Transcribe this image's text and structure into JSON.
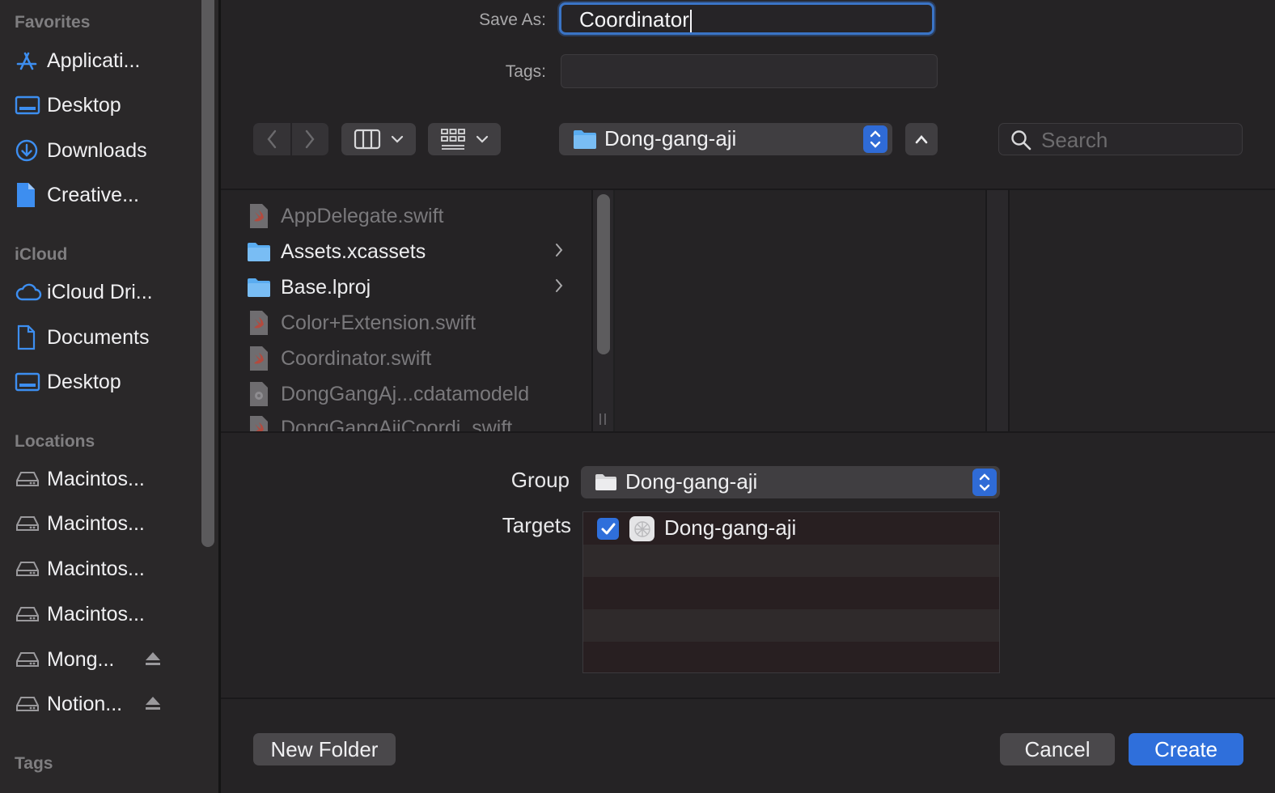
{
  "sidebar": {
    "favorites_heading": "Favorites",
    "favorites": [
      {
        "label": "Applicati...",
        "icon": "applications-icon"
      },
      {
        "label": "Desktop",
        "icon": "desktop-icon"
      },
      {
        "label": "Downloads",
        "icon": "downloads-icon"
      },
      {
        "label": "Creative...",
        "icon": "document-icon"
      }
    ],
    "icloud_heading": "iCloud",
    "icloud": [
      {
        "label": "iCloud Dri...",
        "icon": "icloud-icon"
      },
      {
        "label": "Documents",
        "icon": "document-outline-icon"
      },
      {
        "label": "Desktop",
        "icon": "desktop-icon"
      }
    ],
    "locations_heading": "Locations",
    "locations": [
      {
        "label": "Macintos...",
        "icon": "disk-icon",
        "eject": false
      },
      {
        "label": "Macintos...",
        "icon": "disk-icon",
        "eject": false
      },
      {
        "label": "Macintos...",
        "icon": "disk-icon",
        "eject": false
      },
      {
        "label": "Macintos...",
        "icon": "disk-icon",
        "eject": false
      },
      {
        "label": "Mong...",
        "icon": "disk-icon",
        "eject": true
      },
      {
        "label": "Notion...",
        "icon": "disk-icon",
        "eject": true
      }
    ],
    "tags_heading": "Tags"
  },
  "form": {
    "save_as_label": "Save As:",
    "save_as_value": "Coordinator",
    "tags_label": "Tags:",
    "tags_value": ""
  },
  "toolbar": {
    "path_folder": "Dong-gang-aji",
    "search_placeholder": "Search"
  },
  "files": [
    {
      "name": "AppDelegate.swift",
      "type": "swift",
      "enabled": false,
      "has_children": false
    },
    {
      "name": "Assets.xcassets",
      "type": "folder",
      "enabled": true,
      "has_children": true
    },
    {
      "name": "Base.lproj",
      "type": "folder",
      "enabled": true,
      "has_children": true
    },
    {
      "name": "Color+Extension.swift",
      "type": "swift",
      "enabled": false,
      "has_children": false
    },
    {
      "name": "Coordinator.swift",
      "type": "swift",
      "enabled": false,
      "has_children": false
    },
    {
      "name": "DongGangAj...cdatamodeld",
      "type": "datamodel",
      "enabled": false,
      "has_children": false
    },
    {
      "name": "DongGangAjiCoordi..swift",
      "type": "swift",
      "enabled": false,
      "has_children": false
    }
  ],
  "options": {
    "group_label": "Group",
    "group_value": "Dong-gang-aji",
    "targets_label": "Targets",
    "targets": [
      {
        "name": "Dong-gang-aji",
        "checked": true
      }
    ]
  },
  "buttons": {
    "new_folder": "New Folder",
    "cancel": "Cancel",
    "create": "Create"
  },
  "colors": {
    "accent": "#2f6fdb",
    "folder": "#5aacf0",
    "sidebar_icon": "#3d8ef0"
  }
}
